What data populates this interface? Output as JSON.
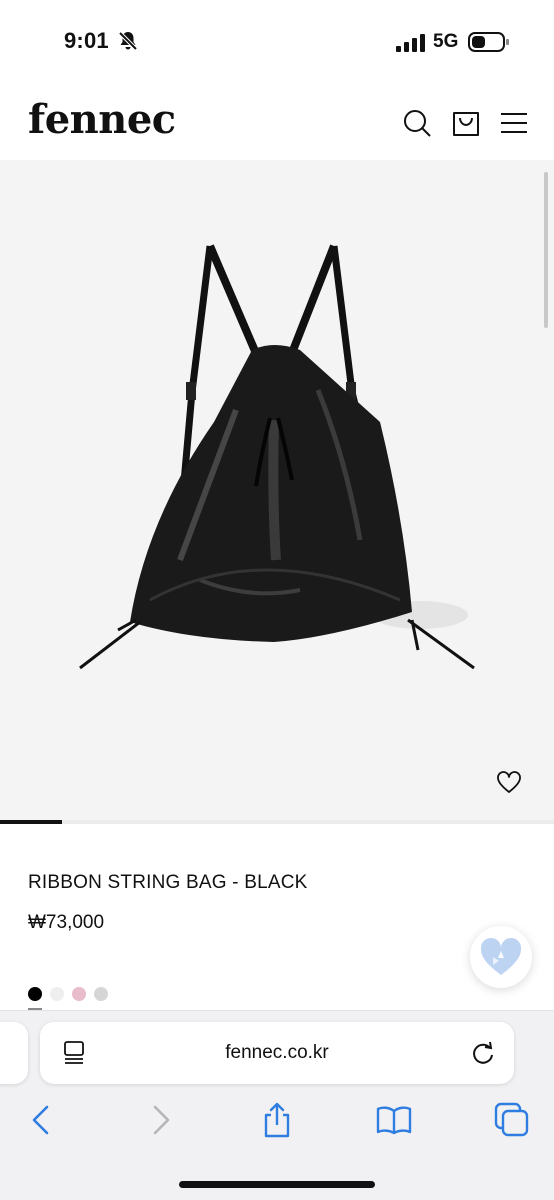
{
  "status_bar": {
    "time": "9:01",
    "network": "5G",
    "icons": [
      "bell-slash-icon",
      "signal-icon",
      "battery-icon"
    ]
  },
  "header": {
    "logo": "fennec",
    "icons": [
      "search-icon",
      "shopping-bag-icon",
      "menu-icon"
    ]
  },
  "product": {
    "image": "black-drawstring-backpack",
    "title": "RIBBON STRING BAG - BLACK",
    "price": "₩73,000",
    "swatches": [
      "#000000",
      "#eeeeee",
      "#e9bccb",
      "#d6d6d6"
    ],
    "selected_swatch": 0,
    "carousel_position": 1,
    "wishlist_icon": "heart-outline-icon",
    "floating_icon": "heart-badge-icon"
  },
  "browser": {
    "url": "fennec.co.kr",
    "toolbar_icons": [
      "back-icon",
      "forward-icon",
      "share-icon",
      "bookmarks-icon",
      "tabs-icon"
    ],
    "accent": "#2f7de1"
  }
}
